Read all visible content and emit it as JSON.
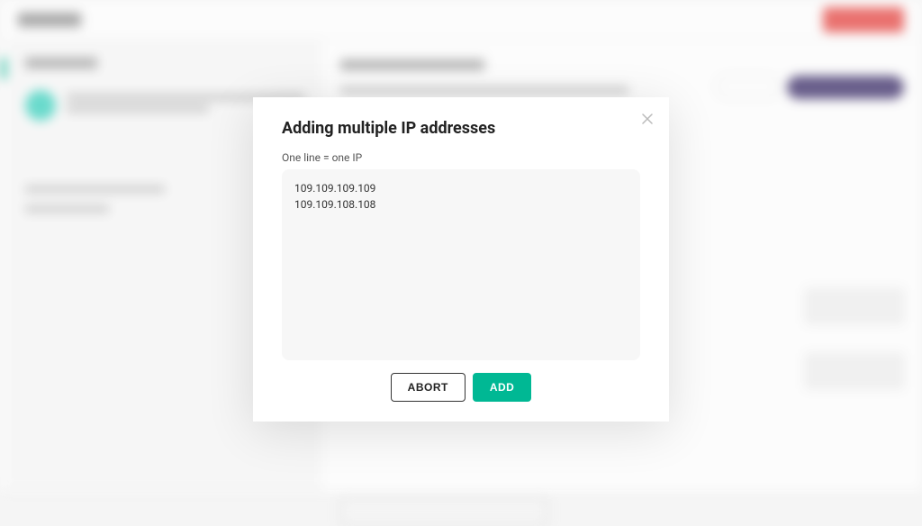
{
  "modal": {
    "title": "Adding multiple IP addresses",
    "hint": "One line = one IP",
    "textarea_value": "109.109.109.109\n109.109.108.108",
    "abort_label": "ABORT",
    "add_label": "ADD",
    "close_icon_label": "close"
  },
  "colors": {
    "accent_green": "#00b894",
    "danger_red": "#e53935",
    "brand_dark": "#2c1d5d"
  }
}
